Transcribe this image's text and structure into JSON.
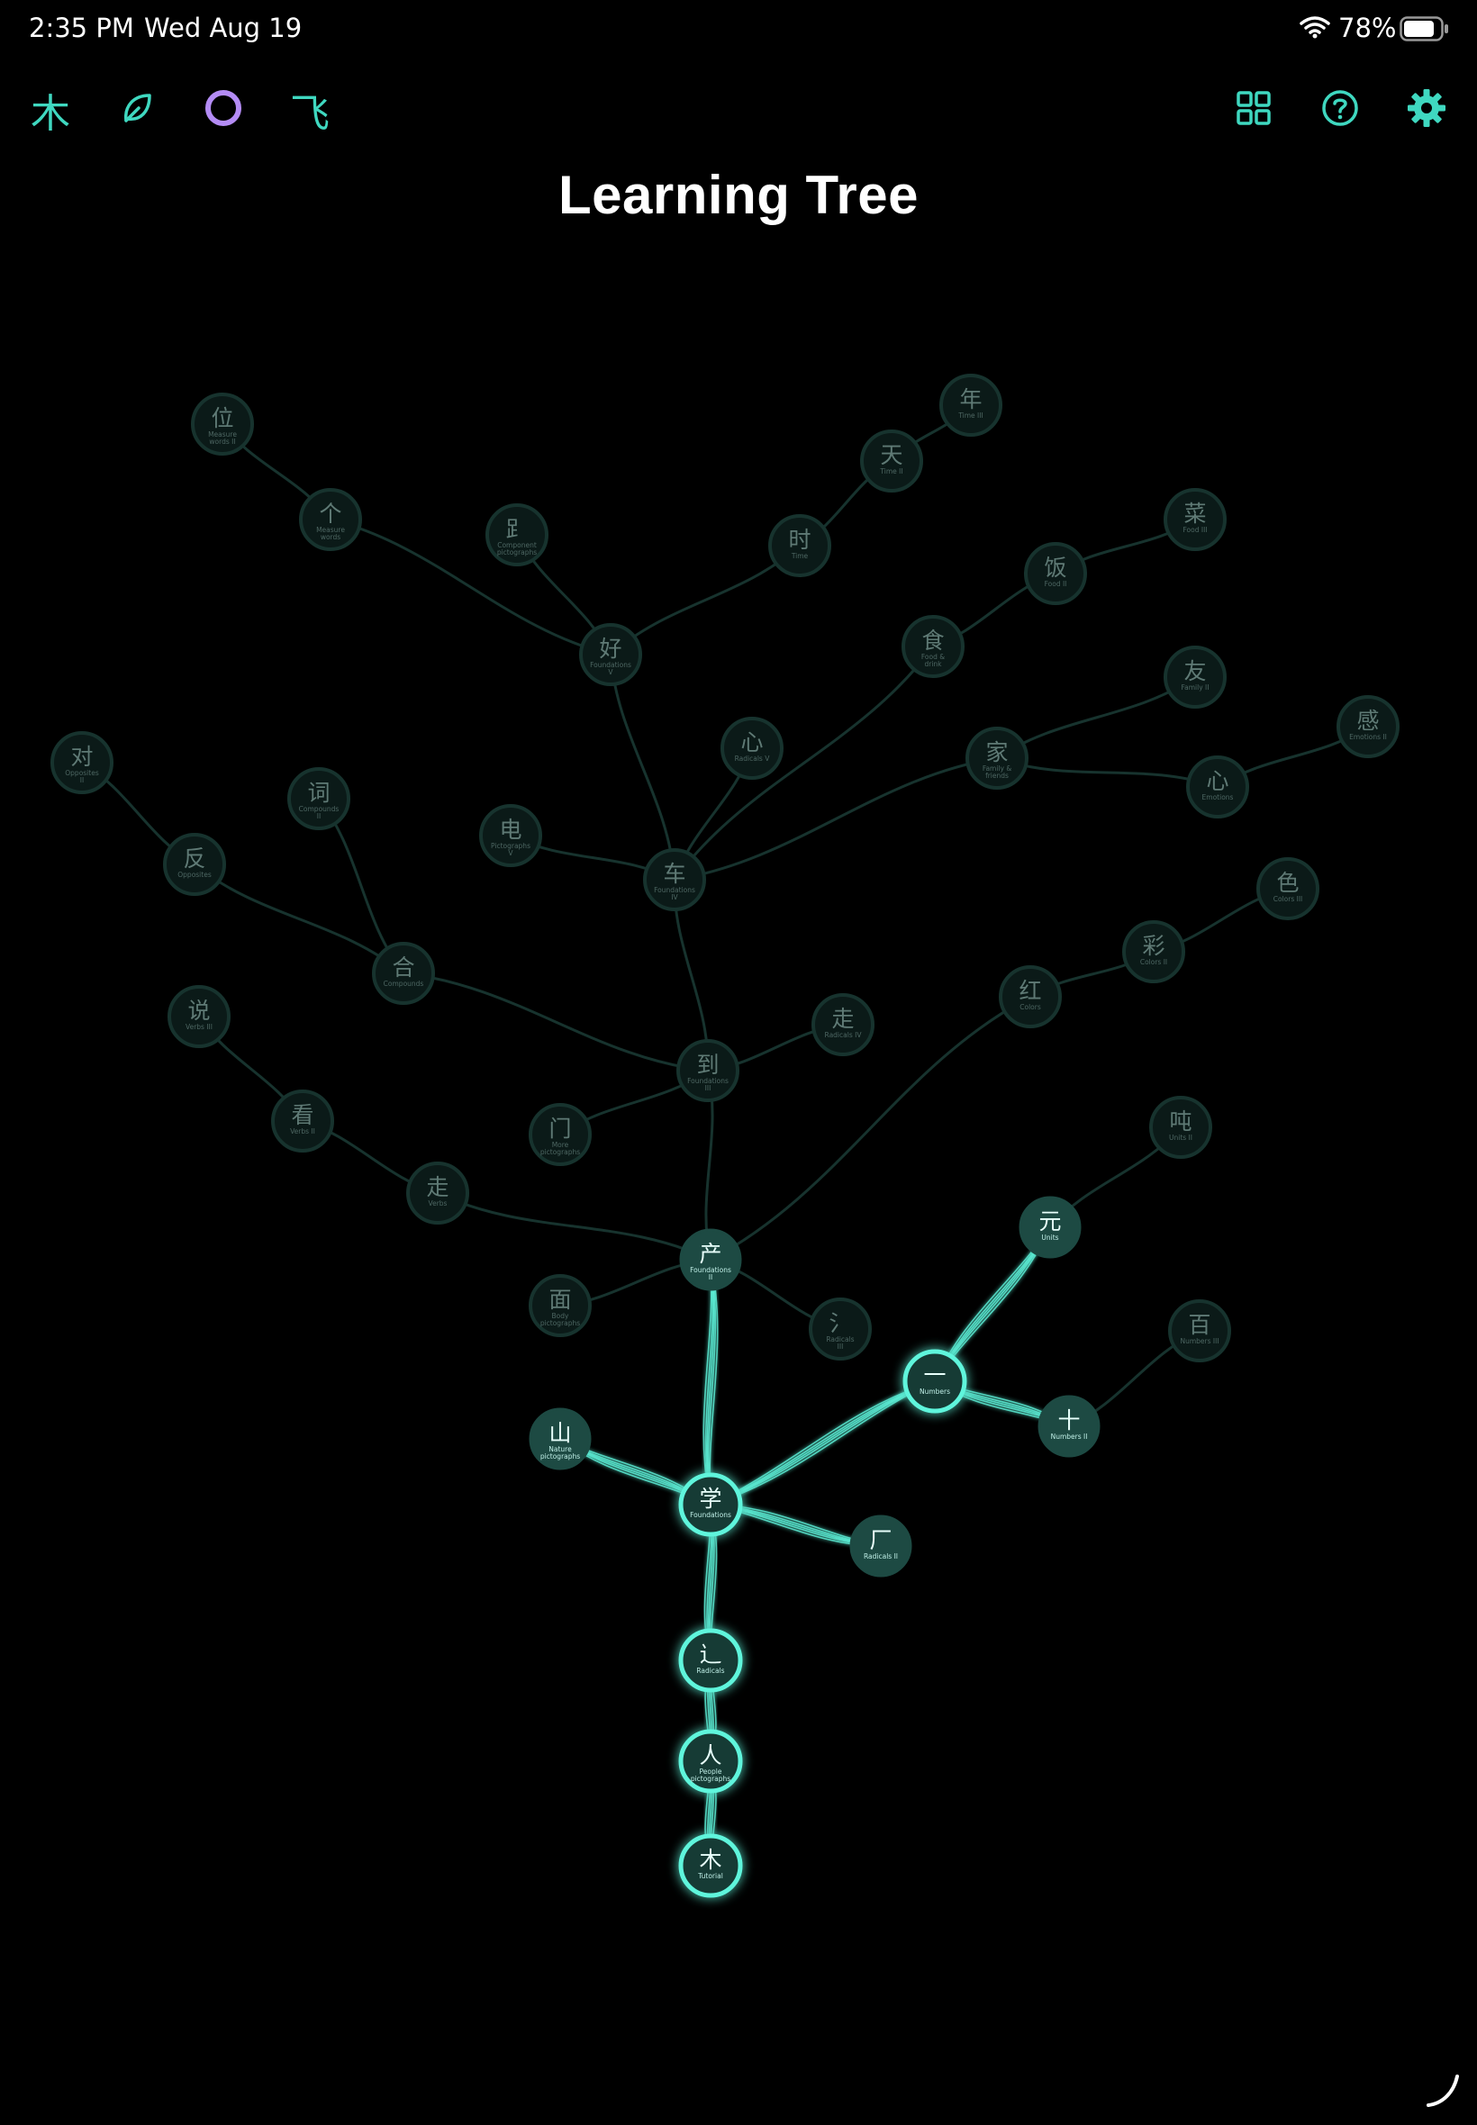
{
  "status_bar": {
    "time": "2:35 PM",
    "date": "Wed Aug 19",
    "battery": "78%"
  },
  "toolbar": {
    "left": [
      {
        "name": "tree-tab-button",
        "glyph": "木"
      },
      {
        "name": "leaf-tab-button",
        "icon": "leaf-icon"
      },
      {
        "name": "ring-tab-button",
        "icon": "circle-icon"
      },
      {
        "name": "fly-tab-button",
        "glyph": "飞"
      }
    ],
    "right": [
      {
        "name": "grid-button",
        "icon": "grid-icon"
      },
      {
        "name": "help-button",
        "icon": "help-icon"
      },
      {
        "name": "settings-button",
        "icon": "gear-icon"
      }
    ]
  },
  "title": "Learning Tree",
  "colors": {
    "accent": "#3fd8c0",
    "ring_accent": "#b48cf5",
    "active_fill": "#123a34",
    "dim_fill": "#0b1a18",
    "dim_stroke": "#17332e",
    "glow": "#5ff5dc"
  },
  "tree": {
    "nodes": [
      {
        "id": "mu",
        "char": "木",
        "label": "Tutorial",
        "state": "unlocked"
      },
      {
        "id": "ren",
        "char": "人",
        "label": "People pictographs",
        "state": "unlocked"
      },
      {
        "id": "chuo",
        "char": "辶",
        "label": "Radicals",
        "state": "unlocked"
      },
      {
        "id": "xue",
        "char": "学",
        "label": "Foundations",
        "state": "unlocked"
      },
      {
        "id": "shan",
        "char": "山",
        "label": "Nature pictographs",
        "state": "available"
      },
      {
        "id": "han",
        "char": "厂",
        "label": "Radicals II",
        "state": "available"
      },
      {
        "id": "yi",
        "char": "一",
        "label": "Numbers",
        "state": "unlocked"
      },
      {
        "id": "shi10",
        "char": "十",
        "label": "Numbers II",
        "state": "available"
      },
      {
        "id": "yuan",
        "char": "元",
        "label": "Units",
        "state": "available"
      },
      {
        "id": "bai",
        "char": "百",
        "label": "Numbers III",
        "state": "locked"
      },
      {
        "id": "dun",
        "char": "吨",
        "label": "Units II",
        "state": "locked"
      },
      {
        "id": "chan",
        "char": "产",
        "label": "Foundations II",
        "state": "available"
      },
      {
        "id": "mian",
        "char": "面",
        "label": "Body pictographs",
        "state": "locked"
      },
      {
        "id": "shui",
        "char": "氵",
        "label": "Radicals III",
        "state": "locked"
      },
      {
        "id": "zou_v",
        "char": "走",
        "label": "Verbs",
        "state": "locked"
      },
      {
        "id": "kan",
        "char": "看",
        "label": "Verbs II",
        "state": "locked"
      },
      {
        "id": "shuo",
        "char": "说",
        "label": "Verbs III",
        "state": "locked"
      },
      {
        "id": "dao",
        "char": "到",
        "label": "Foundations III",
        "state": "locked"
      },
      {
        "id": "men",
        "char": "门",
        "label": "More pictographs",
        "state": "locked"
      },
      {
        "id": "zou_r",
        "char": "走",
        "label": "Radicals IV",
        "state": "locked"
      },
      {
        "id": "hong",
        "char": "红",
        "label": "Colors",
        "state": "locked"
      },
      {
        "id": "cai",
        "char": "彩",
        "label": "Colors II",
        "state": "locked"
      },
      {
        "id": "se",
        "char": "色",
        "label": "Colors III",
        "state": "locked"
      },
      {
        "id": "he",
        "char": "合",
        "label": "Compounds",
        "state": "locked"
      },
      {
        "id": "ci",
        "char": "词",
        "label": "Compounds II",
        "state": "locked"
      },
      {
        "id": "fan",
        "char": "反",
        "label": "Opposites",
        "state": "locked"
      },
      {
        "id": "dui",
        "char": "对",
        "label": "Opposites II",
        "state": "locked"
      },
      {
        "id": "che",
        "char": "车",
        "label": "Foundations IV",
        "state": "locked"
      },
      {
        "id": "dian",
        "char": "电",
        "label": "Pictographs V",
        "state": "locked"
      },
      {
        "id": "xin_r",
        "char": "心",
        "label": "Radicals V",
        "state": "locked"
      },
      {
        "id": "jia",
        "char": "家",
        "label": "Family & friends",
        "state": "locked"
      },
      {
        "id": "you",
        "char": "友",
        "label": "Family II",
        "state": "locked"
      },
      {
        "id": "xin_e",
        "char": "心",
        "label": "Emotions",
        "state": "locked"
      },
      {
        "id": "gan",
        "char": "感",
        "label": "Emotions II",
        "state": "locked"
      },
      {
        "id": "shi_f",
        "char": "食",
        "label": "Food & drink",
        "state": "locked"
      },
      {
        "id": "fanfood",
        "char": "饭",
        "label": "Food II",
        "state": "locked"
      },
      {
        "id": "cai_f",
        "char": "菜",
        "label": "Food III",
        "state": "locked"
      },
      {
        "id": "hao",
        "char": "好",
        "label": "Foundations V",
        "state": "locked"
      },
      {
        "id": "zu",
        "char": "⻊",
        "label": "Component pictographs",
        "state": "locked"
      },
      {
        "id": "ge",
        "char": "个",
        "label": "Measure words",
        "state": "locked"
      },
      {
        "id": "wei",
        "char": "位",
        "label": "Measure words II",
        "state": "locked"
      },
      {
        "id": "shi_t",
        "char": "时",
        "label": "Time",
        "state": "locked"
      },
      {
        "id": "tian",
        "char": "天",
        "label": "Time II",
        "state": "locked"
      },
      {
        "id": "nian",
        "char": "年",
        "label": "Time III",
        "state": "locked"
      }
    ],
    "edges": [
      [
        "mu",
        "ren"
      ],
      [
        "ren",
        "chuo"
      ],
      [
        "chuo",
        "xue"
      ],
      [
        "xue",
        "shan"
      ],
      [
        "xue",
        "han"
      ],
      [
        "xue",
        "yi"
      ],
      [
        "xue",
        "chan"
      ],
      [
        "yi",
        "shi10"
      ],
      [
        "yi",
        "yuan"
      ],
      [
        "shi10",
        "bai"
      ],
      [
        "yuan",
        "dun"
      ],
      [
        "chan",
        "mian"
      ],
      [
        "chan",
        "shui"
      ],
      [
        "chan",
        "zou_v"
      ],
      [
        "chan",
        "dao"
      ],
      [
        "chan",
        "hong"
      ],
      [
        "zou_v",
        "kan"
      ],
      [
        "kan",
        "shuo"
      ],
      [
        "dao",
        "men"
      ],
      [
        "dao",
        "zou_r"
      ],
      [
        "dao",
        "he"
      ],
      [
        "dao",
        "che"
      ],
      [
        "hong",
        "cai"
      ],
      [
        "cai",
        "se"
      ],
      [
        "he",
        "ci"
      ],
      [
        "he",
        "fan"
      ],
      [
        "fan",
        "dui"
      ],
      [
        "che",
        "dian"
      ],
      [
        "che",
        "xin_r"
      ],
      [
        "che",
        "jia"
      ],
      [
        "che",
        "shi_f"
      ],
      [
        "che",
        "hao"
      ],
      [
        "jia",
        "you"
      ],
      [
        "jia",
        "xin_e"
      ],
      [
        "xin_e",
        "gan"
      ],
      [
        "shi_f",
        "fanfood"
      ],
      [
        "fanfood",
        "cai_f"
      ],
      [
        "hao",
        "zu"
      ],
      [
        "hao",
        "ge"
      ],
      [
        "ge",
        "wei"
      ],
      [
        "hao",
        "shi_t"
      ],
      [
        "shi_t",
        "tian"
      ],
      [
        "tian",
        "nian"
      ]
    ]
  }
}
